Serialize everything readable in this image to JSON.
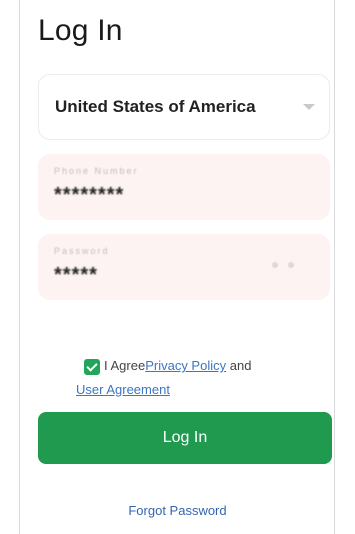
{
  "page": {
    "title": "Log In"
  },
  "country": {
    "value": "United States of America"
  },
  "phone_field": {
    "label": "Phone Number",
    "value": "********"
  },
  "password_field": {
    "label": "Password",
    "value": "*****"
  },
  "agreement": {
    "prefix": "I Agree",
    "privacy_link": "Privacy Policy",
    "conjunction": " and",
    "user_agreement_link": "User Agreement"
  },
  "login_button": {
    "label": "Log In"
  },
  "forgot_password": {
    "label": "Forgot Password"
  },
  "colors": {
    "primary": "#1f9a4e",
    "link": "#3b76c4",
    "input_bg": "#fdf3f3"
  }
}
